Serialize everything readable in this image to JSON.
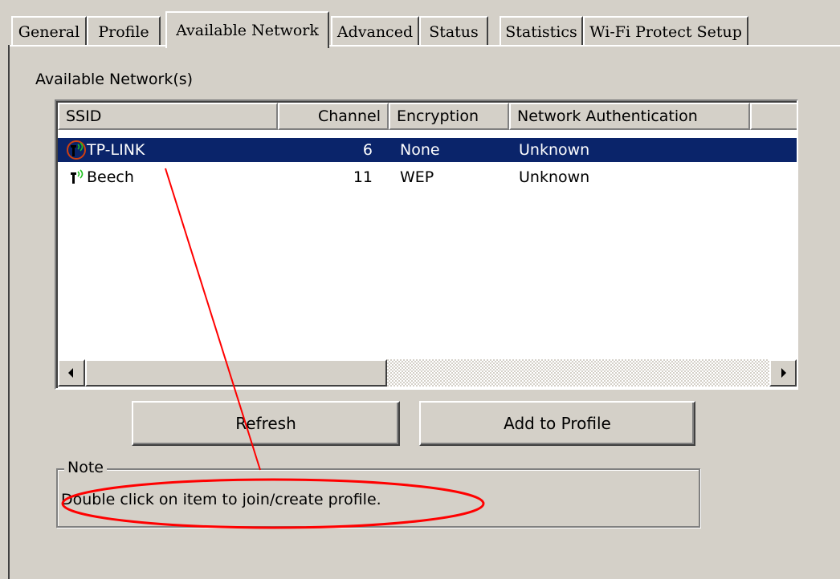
{
  "tabs": [
    {
      "label": "General",
      "active": false
    },
    {
      "label": "Profile",
      "active": false
    },
    {
      "label": "Available Network",
      "active": true
    },
    {
      "label": "Advanced",
      "active": false
    },
    {
      "label": "Status",
      "active": false
    },
    {
      "label": "Statistics",
      "active": false
    },
    {
      "label": "Wi-Fi Protect Setup",
      "active": false
    }
  ],
  "section_label": "Available Network(s)",
  "network_list": {
    "columns": [
      "SSID",
      "Channel",
      "Encryption",
      "Network Authentication"
    ],
    "rows": [
      {
        "ssid": "TP-LINK",
        "channel": "6",
        "encryption": "None",
        "auth": "Unknown",
        "selected": true,
        "icon": "wifi-signal-icon"
      },
      {
        "ssid": "Beech",
        "channel": "11",
        "encryption": "WEP",
        "auth": "Unknown",
        "selected": false,
        "icon": "wifi-signal-icon"
      }
    ]
  },
  "buttons": {
    "refresh": "Refresh",
    "add_to_profile": "Add to Profile"
  },
  "note": {
    "title": "Note",
    "text": "Double click on item to join/create profile."
  },
  "colors": {
    "selection": "#0a246a",
    "window": "#d4d0c8",
    "annotation": "#ff0000"
  }
}
